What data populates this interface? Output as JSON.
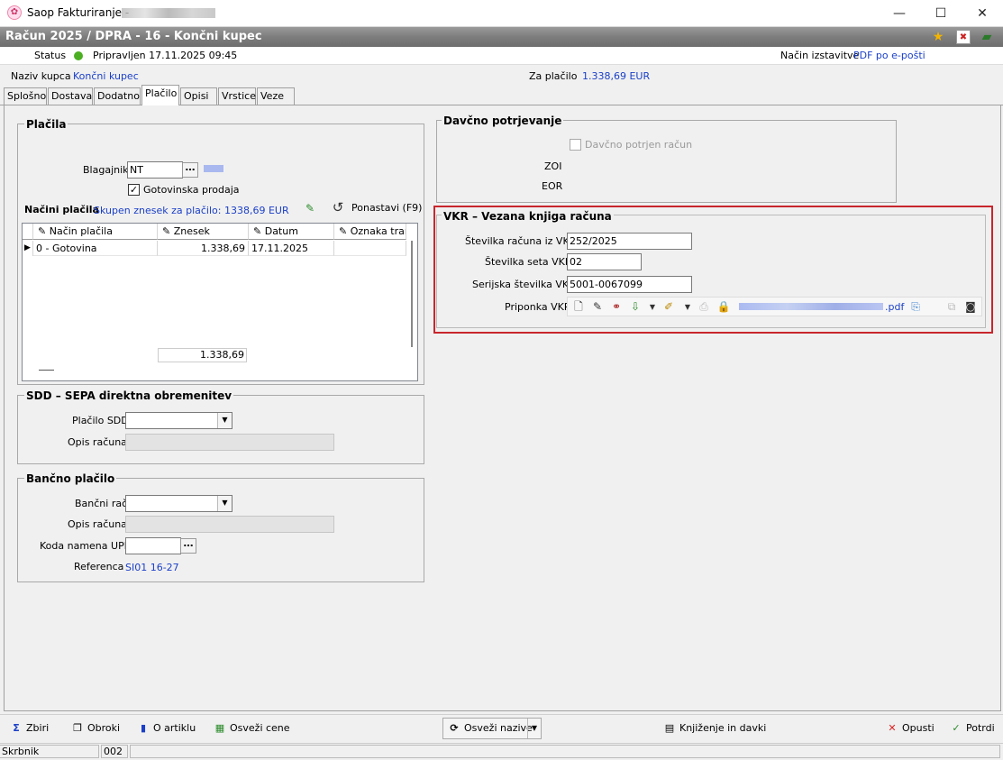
{
  "window": {
    "app_title": "Saop Fakturiranje -",
    "minimize": "—",
    "maximize": "☐",
    "close": "✕"
  },
  "document": {
    "header": "Račun  2025 / DPRA - 16 - Končni kupec"
  },
  "status": {
    "label": "Status",
    "value": "Pripravljen 17.11.2025 09:45",
    "delivery_label": "Način izstavitve",
    "delivery_value": "PDF po e-pošti"
  },
  "customer": {
    "label": "Naziv kupca",
    "value": "Končni kupec",
    "pay_label": "Za plačilo",
    "pay_value": "1.338,69 EUR"
  },
  "tabs": [
    {
      "label": "Splošno"
    },
    {
      "label": "Dostava"
    },
    {
      "label": "Dodatno"
    },
    {
      "label": "Plačilo"
    },
    {
      "label": "Opisi"
    },
    {
      "label": "Vrstice"
    },
    {
      "label": "Veze"
    }
  ],
  "placila": {
    "title": "Plačila",
    "blagajnik_label": "Blagajnik",
    "blagajnik_value": "NT",
    "gotovinska_label": "Gotovinska prodaja",
    "gotovinska_checked": true,
    "nacini_label": "Načini plačila",
    "skupen_label": "Skupen znesek za plačilo: 1338,69 EUR",
    "ponastavi_label": "Ponastavi (F9)",
    "columns": [
      "Način plačila",
      "Znesek",
      "Datum",
      "Oznaka tran"
    ],
    "rows": [
      {
        "nacin": "0 - Gotovina",
        "znesek": "1.338,69",
        "datum": "17.11.2025",
        "oznaka": ""
      }
    ],
    "total": "1.338,69"
  },
  "sdd": {
    "title": "SDD – SEPA direktna obremenitev",
    "placilo_label": "Plačilo SDD",
    "opis_label": "Opis računa"
  },
  "bancno": {
    "title": "Bančno plačilo",
    "racun_label": "Bančni račun",
    "opis_label": "Opis računa",
    "koda_label": "Koda namena UPN",
    "referenca_label": "Referenca",
    "referenca_value": "SI01 16-27"
  },
  "davcno": {
    "title": "Davčno potrjevanje",
    "potrjen_label": "Davčno potrjen račun",
    "zoi_label": "ZOI",
    "eor_label": "EOR"
  },
  "vkr": {
    "title": "VKR – Vezana knjiga računa",
    "stevilka_label": "Številka računa iz VKR",
    "stevilka_value": "252/2025",
    "seta_label": "Številka seta VKR",
    "seta_value": "02",
    "serijska_label": "Serijska številka VKR",
    "serijska_value": "5001-0067099",
    "priponka_label": "Priponka VKR",
    "priponka_file": ".pdf"
  },
  "bottom": {
    "zbiri": "Zbiri",
    "obroki": "Obroki",
    "o_artiklu": "O artiklu",
    "osvezi_cene": "Osveži cene",
    "osvezi_nazive": "Osveži nazive",
    "knjizenje": "Knjiženje in davki",
    "opusti": "Opusti",
    "potrdi": "Potrdi"
  },
  "statusbar": {
    "user": "Skrbnik",
    "code": "002"
  },
  "colors": {
    "accent_red": "#c8262c",
    "link_blue": "#1a3fc8",
    "header_gray": "#7d7d7d"
  }
}
